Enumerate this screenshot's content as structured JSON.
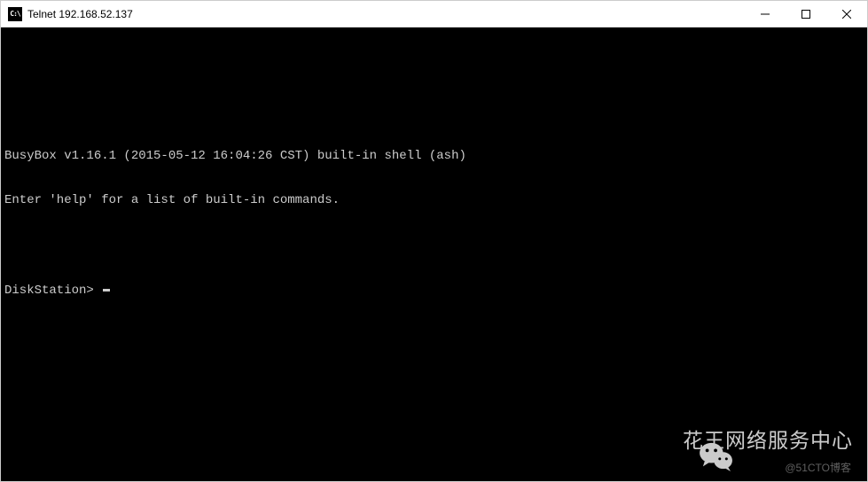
{
  "window": {
    "icon_text": "C:\\",
    "title": "Telnet 192.168.52.137"
  },
  "terminal": {
    "blank1": "",
    "blank2": "",
    "line1": "BusyBox v1.16.1 (2015-05-12 16:04:26 CST) built-in shell (ash)",
    "line2": "Enter 'help' for a list of built-in commands.",
    "blank3": "",
    "prompt": "DiskStation> "
  },
  "watermark": {
    "text": "花王网络服务中心",
    "sub": "@51CTO博客"
  }
}
